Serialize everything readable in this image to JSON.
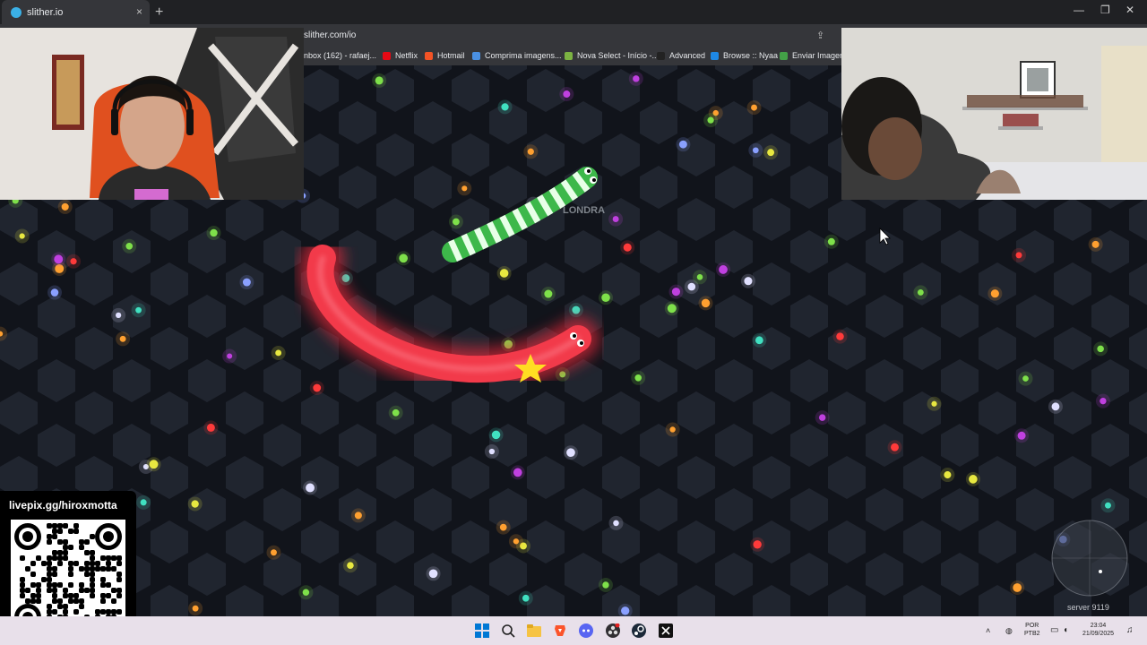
{
  "browser": {
    "tab_title": "slither.io",
    "tab_close": "×",
    "new_tab": "+",
    "url": "slither.com/io",
    "window_controls": {
      "minimize": "—",
      "maximize": "❐",
      "close": "✕"
    }
  },
  "bookmarks": [
    {
      "label": "nbox (162) - rafaej...",
      "color": "#4285f4"
    },
    {
      "label": "Netflix",
      "color": "#e50914"
    },
    {
      "label": "Hotmail",
      "color": "#f35325"
    },
    {
      "label": "Comprima imagens...",
      "color": "#4a90e2"
    },
    {
      "label": "Nova Select - Início -...",
      "color": "#7cb342"
    },
    {
      "label": "Advanced",
      "color": "#222222"
    },
    {
      "label": "Browse :: Nyaa",
      "color": "#1e88e5"
    },
    {
      "label": "Enviar Imagem",
      "color": "#43a047"
    }
  ],
  "game": {
    "player_name": "LONDRA",
    "server": "server 9119"
  },
  "overlay": {
    "livepix_label": "livepix.gg/hiroxmotta"
  },
  "taskbar": {
    "language": "POR",
    "layout": "PTB2",
    "time": "23:04",
    "date": "21/09/2025"
  }
}
